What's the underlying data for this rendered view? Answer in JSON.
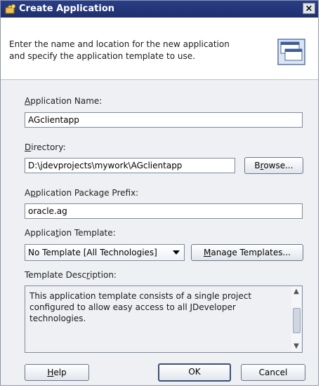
{
  "window": {
    "title": "Create Application",
    "close_glyph": "×"
  },
  "header": {
    "description": "Enter the name and location for the new application\nand specify the application template to use."
  },
  "fields": {
    "app_name": {
      "label_pre": "",
      "label_key": "A",
      "label_post": "pplication Name:",
      "value": "AGclientapp"
    },
    "directory": {
      "label_pre": "",
      "label_key": "D",
      "label_post": "irectory:",
      "value": "D:\\jdevprojects\\mywork\\AGclientapp"
    },
    "prefix": {
      "label_pre": "A",
      "label_key": "p",
      "label_post": "plication Package Prefix:",
      "value": "oracle.ag"
    },
    "template": {
      "label_pre": "Applica",
      "label_key": "t",
      "label_post": "ion Template:",
      "value": "No Template [All Technologies]"
    },
    "description": {
      "label_pre": "Template Desc",
      "label_key": "r",
      "label_post": "iption:",
      "value": "This application template consists of a single project configured to allow easy access to all JDeveloper technologies."
    }
  },
  "buttons": {
    "browse": {
      "pre": "B",
      "key": "r",
      "post": "owse..."
    },
    "manage": {
      "pre": "",
      "key": "M",
      "post": "anage Templates..."
    },
    "help": {
      "pre": "",
      "key": "H",
      "post": "elp"
    },
    "ok": {
      "label": "OK"
    },
    "cancel": {
      "label": "Cancel"
    }
  },
  "icons": {
    "title_icon": "create-application-icon",
    "header_icon": "application-window-icon",
    "combo_arrow": "chevron-down-icon",
    "scroll_up": "scroll-up-icon",
    "scroll_down": "scroll-down-icon"
  },
  "colors": {
    "titlebar": "#1f2f6e",
    "dialog_bg": "#eef0f4",
    "border": "#7f8b9c"
  }
}
